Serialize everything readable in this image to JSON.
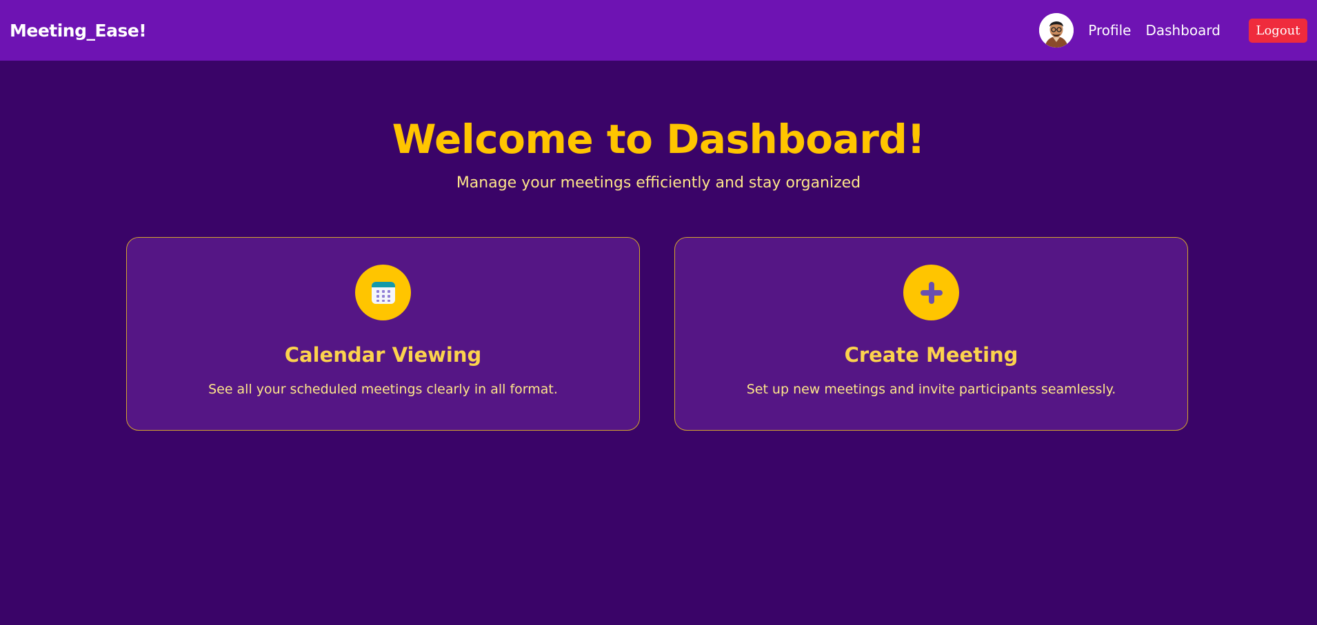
{
  "navbar": {
    "brand": "Meeting_Ease!",
    "links": {
      "profile": "Profile",
      "dashboard": "Dashboard"
    },
    "logout_label": "Logout"
  },
  "hero": {
    "title": "Welcome to Dashboard!",
    "subtitle": "Manage your meetings efficiently and stay organized"
  },
  "cards": [
    {
      "icon": "calendar-icon",
      "title": "Calendar Viewing",
      "description": "See all your scheduled meetings clearly in all format."
    },
    {
      "icon": "plus-icon",
      "title": "Create Meeting",
      "description": "Set up new meetings and invite participants seamlessly."
    }
  ],
  "colors": {
    "background": "#3a0468",
    "navbar": "#6e13b3",
    "accent": "#ffc500",
    "card": "#551685",
    "logout": "#ef2b3d"
  }
}
